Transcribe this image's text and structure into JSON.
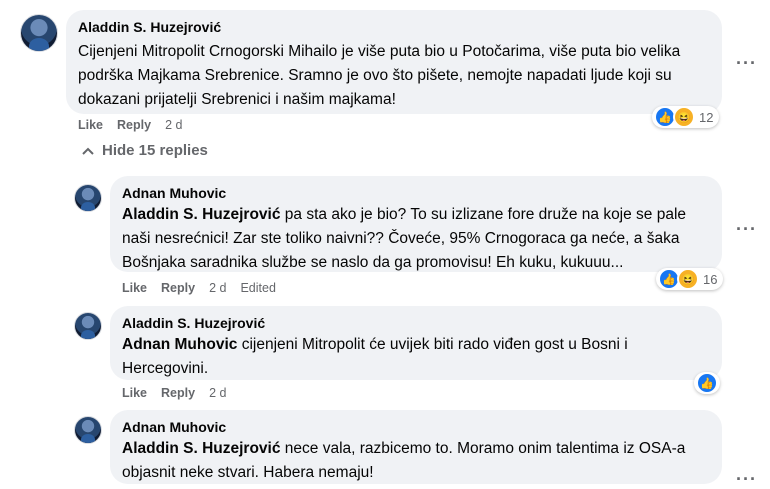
{
  "comments": [
    {
      "author": "Aladdin S. Huzejrović",
      "text": "Cijenjeni Mitropolit Crnogorski Mihailo je više puta bio u Potočarima, više puta bio velika podrška Majkama Srebrenice. Sramno je ovo što pišete, nemojte napadati ljude koji su dokazani prijatelji Srebrenici i našim majkama!",
      "like_label": "Like",
      "reply_label": "Reply",
      "time": "2 d",
      "reaction_count": "12"
    }
  ],
  "hide_replies_label": "Hide 15 replies",
  "replies": [
    {
      "author": "Adnan Muhovic",
      "mention": "Aladdin S. Huzejrović",
      "text": " pa sta ako je bio? To su izlizane fore druže na koje se pale naši nesrećnici! Zar ste toliko naivni?? Čoveće, 95% Crnogoraca ga neće, a šaka Bošnjaka saradnika službe se naslo da ga promovisu! Eh kuku, kukuuu...",
      "like_label": "Like",
      "reply_label": "Reply",
      "time": "2 d",
      "edited": "Edited",
      "reaction_count": "16"
    },
    {
      "author": "Aladdin S. Huzejrović",
      "mention": "Adnan Muhovic",
      "text": " cijenjeni Mitropolit će uvijek biti rado viđen gost u Bosni i Hercegovini.",
      "like_label": "Like",
      "reply_label": "Reply",
      "time": "2 d"
    },
    {
      "author": "Adnan Muhovic",
      "mention": "Aladdin S. Huzejrović",
      "text": " nece vala, razbicemo to. Moramo onim talentima iz OSA-a objasnit neke stvari. Habera nemaju!"
    }
  ],
  "icons": {
    "more": "more-options-icon",
    "chevron": "chevron-up-icon",
    "like_reaction": "like-reaction-icon",
    "haha_reaction": "haha-reaction-icon"
  },
  "colors": {
    "bubble": "#f0f2f5",
    "secondary_text": "#65676b",
    "like_blue": "#1877f2",
    "haha_yellow": "#f7b125"
  }
}
